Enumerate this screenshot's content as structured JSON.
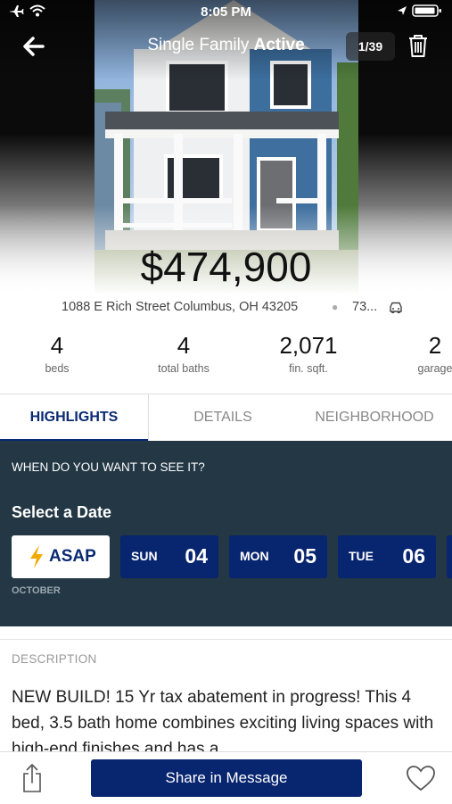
{
  "status_bar": {
    "time": "8:05 PM"
  },
  "header": {
    "title_prefix": "Single Family",
    "title_status": "Active",
    "photo_counter": "1/39"
  },
  "listing": {
    "price": "$474,900",
    "address": "1088 E Rich Street Columbus, OH 43205",
    "commute": "73..."
  },
  "stats": [
    {
      "value": "4",
      "label": "beds"
    },
    {
      "value": "4",
      "label": "total baths"
    },
    {
      "value": "2,071",
      "label": "fin. sqft."
    },
    {
      "value": "2",
      "label": "garage"
    }
  ],
  "tabs": [
    {
      "label": "HIGHLIGHTS"
    },
    {
      "label": "DETAILS"
    },
    {
      "label": "NEIGHBORHOOD"
    }
  ],
  "schedule": {
    "question": "WHEN DO YOU WANT TO SEE IT?",
    "select_label": "Select a Date",
    "asap_label": "ASAP",
    "dates": [
      {
        "dow": "SUN",
        "day": "04"
      },
      {
        "dow": "MON",
        "day": "05"
      },
      {
        "dow": "TUE",
        "day": "06"
      }
    ],
    "month": "OCTOBER"
  },
  "description": {
    "label": "DESCRIPTION",
    "text": "NEW BUILD! 15 Yr tax abatement in progress! This 4 bed, 3.5 bath home combines exciting living spaces with high-end finishes and has a"
  },
  "footer": {
    "share_label": "Share in Message"
  },
  "colors": {
    "brand_navy": "#08256f",
    "schedule_bg": "#233744",
    "asap_bolt": "#f2a900"
  }
}
